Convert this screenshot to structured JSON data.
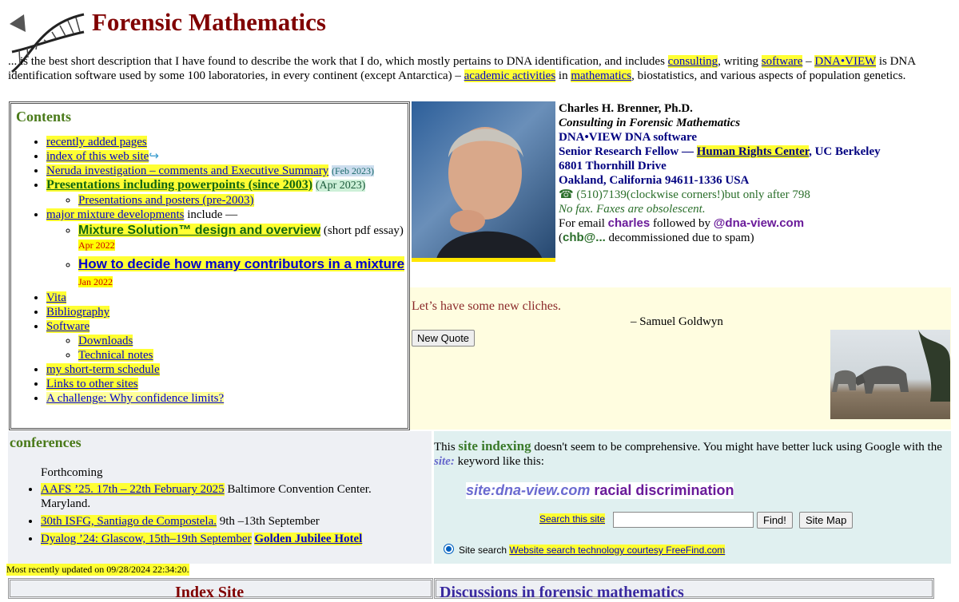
{
  "header": {
    "title": "Forensic Mathematics",
    "intro_pre": "... is the best short description that I have found to describe the work that I do, which mostly pertains to DNA identification, and includes ",
    "link_consulting": "consulting",
    "intro_mid1": ", writing ",
    "link_software": "software",
    "intro_mid2": " – ",
    "link_dnaview": "DNA•VIEW",
    "intro_mid3": " is DNA identification software used by some 100 laboratories, in every continent (except Antarctica) – ",
    "link_academic": "academic activities",
    "intro_mid4": " in ",
    "link_math": "mathematics",
    "intro_end": ", biostatistics, and various aspects of population genetics."
  },
  "contents": {
    "heading": "Contents",
    "recent": "recently added pages",
    "index": "index of this web site",
    "neruda": "Neruda investigation – comments and Executive Summary",
    "neruda_date": "(Feb 2023)",
    "presentations": "Presentations including powerpoints (since 2003)",
    "presentations_date": "(Apr 2023)",
    "pres_pre": "Presentations and posters (pre-2003)",
    "mixture": "major mixture developments",
    "mixture_suffix": " include —",
    "mixture_solution": "Mixture Solution™ design and overview",
    "mixture_solution_note": " (short pdf essay) ",
    "mixture_solution_date": "Apr 2022",
    "contributors": "How to decide how many contributors in a mixture",
    "contributors_date": "Jan 2022",
    "vita": "Vita",
    "bibliography": "Bibliography",
    "software": "Software",
    "downloads": "Downloads",
    "technotes": "Technical notes",
    "schedule": "my short-term schedule",
    "links": "Links to other sites",
    "challenge": "A challenge: Why confidence limits?"
  },
  "contact": {
    "name": "Charles H. Brenner, Ph.D.",
    "consulting": "Consulting in Forensic Mathematics",
    "dnaview": "DNA•VIEW DNA software",
    "fellow_pre": "Senior Research Fellow — ",
    "fellow_link": "Human Rights Center",
    "fellow_post": ", UC Berkeley",
    "street": "6801 Thornhill Drive",
    "city": "Oakland, California 94611-1336 USA",
    "phone": "☎ (510)7139(clockwise corners!)but only after 798",
    "fax": "No fax. Faxes are obsolescent.",
    "email_pre": "For email ",
    "email_user": "charles",
    "email_mid": " followed by ",
    "email_domain": "@dna-view.com",
    "old_pre": "(",
    "old_email": "chb@...",
    "old_post": " decommissioned due to spam)"
  },
  "quote": {
    "text": "Let’s have some new cliches.",
    "author": "– Samuel Goldwyn",
    "button": "New Quote"
  },
  "conferences": {
    "heading": "conferences",
    "forthcoming": "Forthcoming",
    "aafs": "AAFS ’25. 17th – 22th February 2025",
    "aafs_place": " Baltimore Convention Center. Maryland.",
    "isfg": "30th ISFG, Santiago de Compostela.",
    "isfg_dates": " 9th –13th September",
    "dyalog": "Dyalog ’24: Glascow, 15th–19th September",
    "dyalog_hotel": "Golden Jubilee Hotel"
  },
  "search": {
    "pre": "This ",
    "site_indexing": "site indexing",
    "mid": " doesn't seem to be comprehensive. You might have better luck using Google with the ",
    "site_word": "site:",
    "post": " keyword like this:",
    "example_kw": "site:dna-view.com",
    "example_q": " racial discrimination",
    "search_link": "Search this site",
    "find": "Find!",
    "sitemap": "Site Map",
    "radio_label": "Site search ",
    "freefind": "Website search technology courtesy FreeFind.com"
  },
  "footer": {
    "updated": "Most recently updated on 09/28/2024 22:34:20.",
    "index_title": "Index Site",
    "discussions_title": "Discussions in forensic mathematics"
  }
}
